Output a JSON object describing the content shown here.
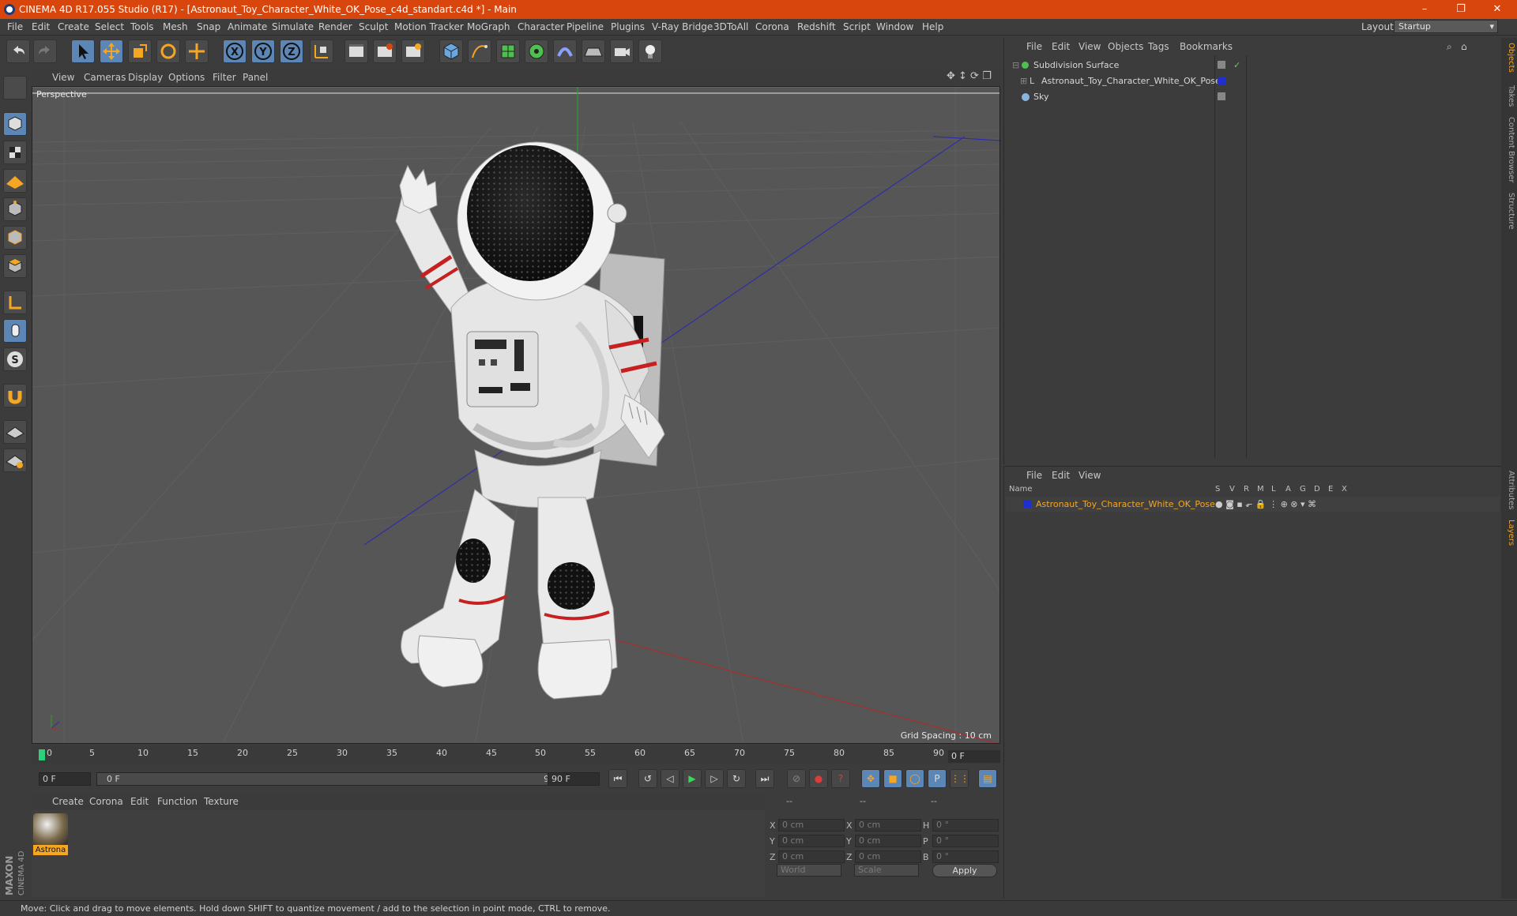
{
  "window": {
    "title": "CINEMA 4D R17.055 Studio (R17) - [Astronaut_Toy_Character_White_OK_Pose_c4d_standart.c4d *] - Main",
    "controls": [
      "–",
      "❐",
      "✕"
    ]
  },
  "menu": [
    "File",
    "Edit",
    "Create",
    "Select",
    "Tools",
    "Mesh",
    "Snap",
    "Animate",
    "Simulate",
    "Render",
    "Sculpt",
    "Motion Tracker",
    "MoGraph",
    "Character",
    "Pipeline",
    "Plugins",
    "V-Ray Bridge",
    "3DToAll",
    "Corona",
    "Redshift",
    "Script",
    "Window",
    "Help"
  ],
  "layout": {
    "label": "Layout:",
    "value": "Startup"
  },
  "viewport": {
    "menu": [
      "View",
      "Cameras",
      "Display",
      "Options",
      "Filter",
      "Panel"
    ],
    "label": "Perspective",
    "grid_spacing": "Grid Spacing : 10 cm"
  },
  "timeline": {
    "ticks": [
      "0",
      "5",
      "10",
      "15",
      "20",
      "25",
      "30",
      "35",
      "40",
      "45",
      "50",
      "55",
      "60",
      "65",
      "70",
      "75",
      "80",
      "85",
      "90"
    ],
    "current_frame": "0 F",
    "start_field": "0 F",
    "range_start": "0 F",
    "range_end": "90 F",
    "end_field": "90 F"
  },
  "material_manager": {
    "menu": [
      "Create",
      "Corona",
      "Edit",
      "Function",
      "Texture"
    ],
    "materials": [
      {
        "name": "Astrona"
      }
    ]
  },
  "coordinates": {
    "headers": [
      "--",
      "--",
      "--"
    ],
    "rows": [
      {
        "a": "X",
        "a_val": "0 cm",
        "b": "X",
        "b_val": "0 cm",
        "c": "H",
        "c_val": "0 °"
      },
      {
        "a": "Y",
        "a_val": "0 cm",
        "b": "Y",
        "b_val": "0 cm",
        "c": "P",
        "c_val": "0 °"
      },
      {
        "a": "Z",
        "a_val": "0 cm",
        "b": "Z",
        "b_val": "0 cm",
        "c": "B",
        "c_val": "0 °"
      }
    ],
    "mode": "World",
    "size_mode": "Scale",
    "apply": "Apply"
  },
  "object_manager": {
    "menu": [
      "File",
      "Edit",
      "View",
      "Objects",
      "Tags",
      "Bookmarks"
    ],
    "objects": [
      {
        "name": "Subdivision Surface"
      },
      {
        "name": "Astronaut_Toy_Character_White_OK_Pose"
      },
      {
        "name": "Sky"
      }
    ]
  },
  "layer_manager": {
    "menu": [
      "File",
      "Edit",
      "View"
    ],
    "column_name": "Name",
    "columns": [
      "S",
      "V",
      "R",
      "M",
      "L",
      "A",
      "G",
      "D",
      "E",
      "X"
    ],
    "layers": [
      {
        "name": "Astronaut_Toy_Character_White_OK_Pose",
        "color": "#1f2fd0"
      }
    ]
  },
  "right_tabs": [
    "Objects",
    "Takes",
    "Content Browser",
    "Structure",
    "Attributes",
    "Layers"
  ],
  "status": "Move: Click and drag to move elements. Hold down SHIFT to quantize movement / add to the selection in point mode, CTRL to remove.",
  "branding": "MAXON CINEMA 4D",
  "colors": {
    "accent": "#d8460e",
    "selection_orange": "#f5a623",
    "icon_blue": "#5b86b5"
  }
}
